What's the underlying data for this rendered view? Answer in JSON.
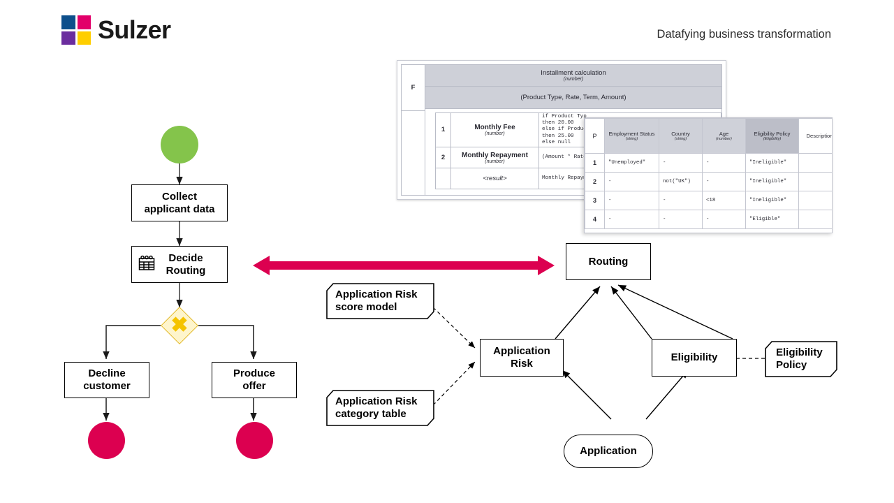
{
  "header": {
    "logo_text": "Sulzer",
    "tagline": "Datafying business transformation",
    "logo_colors": [
      "#0D4F8B",
      "#E2006A",
      "#6B2D9E",
      "#FFCE00"
    ]
  },
  "colors": {
    "start_event": "#84C44B",
    "end_event": "#DC0050",
    "gateway_fill": "#FEF5CC",
    "gateway_stroke": "#E3B92B",
    "gateway_symbol": "#F5C400",
    "arrow_accent": "#DC0050",
    "table_header": "#CFD1D9",
    "table_header_dark": "#BCBEC8",
    "table_border": "#C4C6D0"
  },
  "bpmn": {
    "start_event_name": "start-event",
    "nodes": [
      {
        "id": "collect",
        "label": "Collect\napplicant data",
        "type": "task"
      },
      {
        "id": "decide",
        "label": "Decide\nRouting",
        "type": "business-rule-task",
        "icon": "business-rule-table-icon"
      },
      {
        "id": "gateway",
        "label": "",
        "type": "exclusive-gateway",
        "symbol": "✖"
      },
      {
        "id": "decline",
        "label": "Decline\ncustomer",
        "type": "task"
      },
      {
        "id": "produce",
        "label": "Produce\noffer",
        "type": "task"
      }
    ],
    "end_events": [
      "end-event-decline",
      "end-event-offer"
    ]
  },
  "connector": {
    "type": "double-headed-arrow",
    "color": "#DC0050"
  },
  "dmn": {
    "decisions": [
      {
        "id": "routing",
        "label": "Routing"
      },
      {
        "id": "application_risk",
        "label": "Application\nRisk"
      },
      {
        "id": "eligibility",
        "label": "Eligibility"
      }
    ],
    "input_data": [
      {
        "id": "application",
        "label": "Application"
      }
    ],
    "knowledge_sources": [
      {
        "id": "risk_score_model",
        "label": "Application Risk\nscore model"
      },
      {
        "id": "risk_category_table",
        "label": "Application Risk\ncategory table"
      },
      {
        "id": "eligibility_policy",
        "label": "Eligibility\nPolicy"
      }
    ]
  },
  "back_table": {
    "corner_letter": "F",
    "title": "Installment calculation",
    "title_type": "(number)",
    "signature": "(Product Type, Rate, Term, Amount)",
    "rows": [
      {
        "num": "1",
        "name": "Monthly Fee",
        "type": "(number)",
        "expression": "if Product Typ\nthen 20.00\nelse if Produc\nthen 25.00\nelse null"
      },
      {
        "num": "2",
        "name": "Monthly Repayment",
        "type": "(number)",
        "expression": "(Amount * Rate"
      },
      {
        "num": "",
        "name": "<result>",
        "type": "",
        "expression": "Monthly Repaym"
      }
    ]
  },
  "front_table": {
    "hit_policy": "P",
    "columns": [
      {
        "name": "Employment Status",
        "type": "(string)",
        "style": "input"
      },
      {
        "name": "Country",
        "type": "(string)",
        "style": "input"
      },
      {
        "name": "Age",
        "type": "(number)",
        "style": "input"
      },
      {
        "name": "Eligibility Policy",
        "type": "(Eligibility)",
        "style": "output"
      },
      {
        "name": "Description",
        "type": "",
        "style": "annotation"
      }
    ],
    "rows": [
      {
        "num": "1",
        "cells": [
          "\"Unemployed\"",
          "-",
          "-",
          "\"Ineligible\"",
          ""
        ]
      },
      {
        "num": "2",
        "cells": [
          "-",
          "not(\"UK\")",
          "-",
          "\"Ineligible\"",
          ""
        ]
      },
      {
        "num": "3",
        "cells": [
          "-",
          "-",
          "<18",
          "\"Ineligible\"",
          ""
        ]
      },
      {
        "num": "4",
        "cells": [
          "-",
          "-",
          "-",
          "\"Eligible\"",
          ""
        ]
      }
    ]
  }
}
